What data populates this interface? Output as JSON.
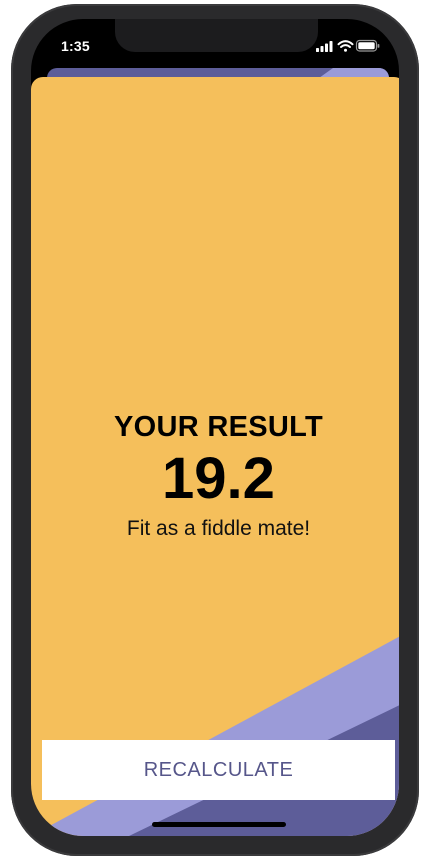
{
  "status_bar": {
    "time": "1:35",
    "icons": [
      "signal-icon",
      "wifi-icon",
      "battery-icon"
    ]
  },
  "result": {
    "title": "YOUR RESULT",
    "value": "19.2",
    "message": "Fit as a fiddle mate!"
  },
  "actions": {
    "recalculate_label": "RECALCULATE"
  },
  "colors": {
    "background": "#f5bf5b",
    "accent_dark": "#5d5d99",
    "accent_light": "#9b9bd8",
    "button_text": "#56568a"
  }
}
